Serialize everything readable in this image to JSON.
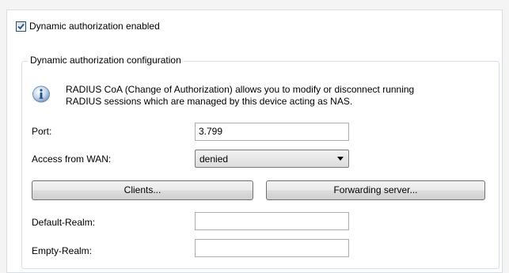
{
  "dynamic_auth": {
    "checkbox_label": "Dynamic authorization enabled",
    "checked": true
  },
  "config_group": {
    "title": "Dynamic authorization configuration",
    "info_icon": "info-icon",
    "info_line1": "RADIUS CoA (Change of Authorization) allows you to modify or disconnect running",
    "info_line2": "RADIUS sessions which are managed by this device acting as NAS.",
    "port": {
      "label": "Port:",
      "value": "3.799"
    },
    "access_from_wan": {
      "label": "Access from WAN:",
      "value": "denied"
    },
    "clients_button": "Clients...",
    "forwarding_button": "Forwarding server...",
    "default_realm": {
      "label": "Default-Realm:",
      "value": ""
    },
    "empty_realm": {
      "label": "Empty-Realm:",
      "value": ""
    }
  }
}
